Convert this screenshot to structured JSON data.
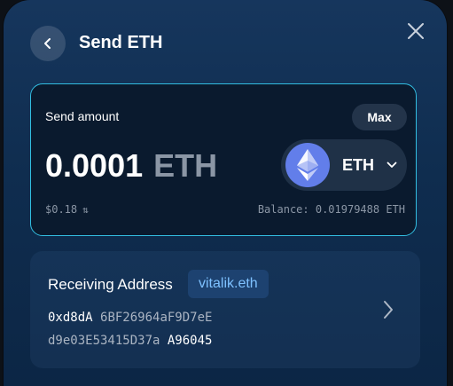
{
  "header": {
    "title": "Send ETH"
  },
  "amount": {
    "label": "Send amount",
    "max_label": "Max",
    "value": "0.0001",
    "unit": "ETH",
    "fiat": "$0.18",
    "balance": "Balance: 0.01979488 ETH"
  },
  "token": {
    "symbol": "ETH",
    "icon": "ethereum-logo"
  },
  "receiving": {
    "label": "Receiving Address",
    "ens": "vitalik.eth",
    "address_parts": [
      "0xd8dA",
      "6BF26964aF9D7eE",
      "d9e03E53415D37a",
      "A96045"
    ]
  },
  "colors": {
    "accent_border": "#32bde0",
    "eth_blue": "#627eea",
    "ens_text": "#7ec1ff"
  },
  "icons": {
    "back": "chevron-left-icon",
    "close": "close-icon",
    "dropdown": "chevron-down-icon",
    "forward": "chevron-right-icon",
    "swap": "swap-icon"
  }
}
